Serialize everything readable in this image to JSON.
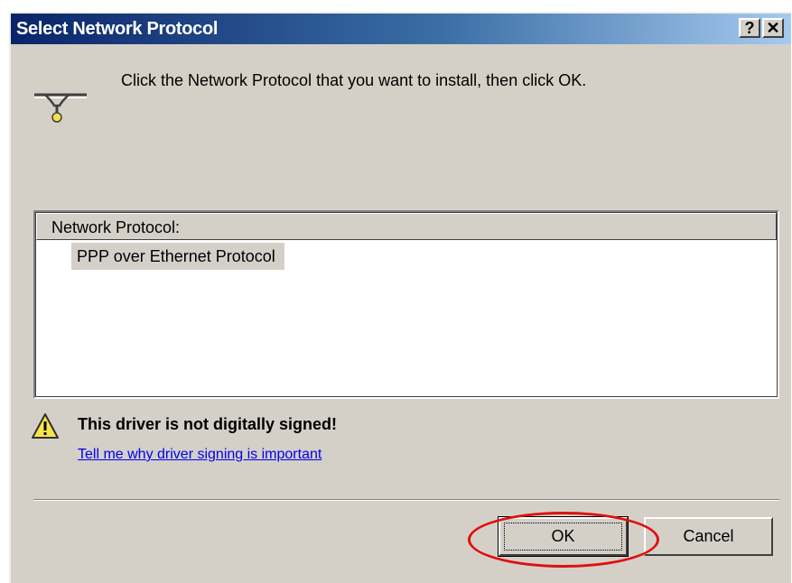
{
  "window": {
    "title": "Select Network Protocol",
    "help_button": "?",
    "close_button": "✕"
  },
  "instruction": "Click the Network Protocol that you want to install, then click OK.",
  "list": {
    "header": "Network Protocol:",
    "items": [
      {
        "label": "PPP over Ethernet Protocol",
        "selected": true
      }
    ]
  },
  "warning": {
    "icon": "warning-icon",
    "text": "This driver is not digitally signed!",
    "link": "Tell me why driver signing is important"
  },
  "buttons": {
    "ok": "OK",
    "cancel": "Cancel"
  },
  "annotation": {
    "highlight_color": "#e01010",
    "highlighted": "ok-button"
  },
  "colors": {
    "title_bar_start": "#0a246a",
    "title_bar_end": "#a6caf0",
    "dialog_background": "#d4d0c8",
    "link": "#0000ee"
  }
}
